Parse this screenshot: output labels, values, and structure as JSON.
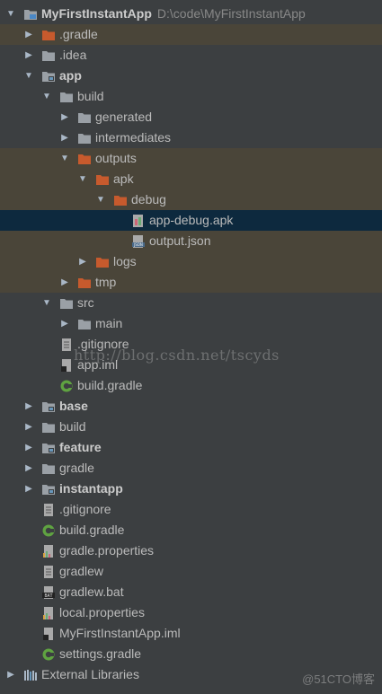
{
  "colors": {
    "background": "#3c3f41",
    "tint_row": "#4a4539",
    "selected_row": "#0d293e",
    "folder": "#b0b0b0",
    "excluded_folder": "#c75a2d",
    "text": "#bbbbbb"
  },
  "tree": [
    {
      "label": "MyFirstInstantApp",
      "path": "D:\\code\\MyFirstInstantApp",
      "depth": 0,
      "arrow": "down",
      "icon": "project-folder-icon",
      "bold": true
    },
    {
      "label": ".gradle",
      "depth": 1,
      "arrow": "right",
      "icon": "excluded-folder-icon",
      "tint": true
    },
    {
      "label": ".idea",
      "depth": 1,
      "arrow": "right",
      "icon": "folder-icon"
    },
    {
      "label": "app",
      "depth": 1,
      "arrow": "down",
      "icon": "module-folder-icon",
      "bold": true
    },
    {
      "label": "build",
      "depth": 2,
      "arrow": "down",
      "icon": "folder-icon"
    },
    {
      "label": "generated",
      "depth": 3,
      "arrow": "right",
      "icon": "folder-icon"
    },
    {
      "label": "intermediates",
      "depth": 3,
      "arrow": "right",
      "icon": "folder-icon"
    },
    {
      "label": "outputs",
      "depth": 3,
      "arrow": "down",
      "icon": "excluded-folder-icon",
      "tint": true
    },
    {
      "label": "apk",
      "depth": 4,
      "arrow": "down",
      "icon": "excluded-folder-icon",
      "tint": true
    },
    {
      "label": "debug",
      "depth": 5,
      "arrow": "down",
      "icon": "excluded-folder-icon",
      "tint": true
    },
    {
      "label": "app-debug.apk",
      "depth": 6,
      "arrow": "none",
      "icon": "apk-file-icon",
      "selected": true
    },
    {
      "label": "output.json",
      "depth": 6,
      "arrow": "none",
      "icon": "json-file-icon",
      "tint": true
    },
    {
      "label": "logs",
      "depth": 4,
      "arrow": "right",
      "icon": "excluded-folder-icon",
      "tint": true
    },
    {
      "label": "tmp",
      "depth": 3,
      "arrow": "right",
      "icon": "excluded-folder-icon",
      "tint": true
    },
    {
      "label": "src",
      "depth": 2,
      "arrow": "down",
      "icon": "folder-icon"
    },
    {
      "label": "main",
      "depth": 3,
      "arrow": "right",
      "icon": "folder-icon"
    },
    {
      "label": ".gitignore",
      "depth": 2,
      "arrow": "none",
      "icon": "text-file-icon"
    },
    {
      "label": "app.iml",
      "depth": 2,
      "arrow": "none",
      "icon": "iml-file-icon"
    },
    {
      "label": "build.gradle",
      "depth": 2,
      "arrow": "none",
      "icon": "gradle-file-icon"
    },
    {
      "label": "base",
      "depth": 1,
      "arrow": "right",
      "icon": "module-folder-icon",
      "bold": true
    },
    {
      "label": "build",
      "depth": 1,
      "arrow": "right",
      "icon": "folder-icon"
    },
    {
      "label": "feature",
      "depth": 1,
      "arrow": "right",
      "icon": "module-folder-icon",
      "bold": true
    },
    {
      "label": "gradle",
      "depth": 1,
      "arrow": "right",
      "icon": "folder-icon"
    },
    {
      "label": "instantapp",
      "depth": 1,
      "arrow": "right",
      "icon": "module-folder-icon",
      "bold": true
    },
    {
      "label": ".gitignore",
      "depth": 1,
      "arrow": "none",
      "icon": "text-file-icon"
    },
    {
      "label": "build.gradle",
      "depth": 1,
      "arrow": "none",
      "icon": "gradle-file-icon"
    },
    {
      "label": "gradle.properties",
      "depth": 1,
      "arrow": "none",
      "icon": "properties-file-icon"
    },
    {
      "label": "gradlew",
      "depth": 1,
      "arrow": "none",
      "icon": "text-file-icon"
    },
    {
      "label": "gradlew.bat",
      "depth": 1,
      "arrow": "none",
      "icon": "bat-file-icon"
    },
    {
      "label": "local.properties",
      "depth": 1,
      "arrow": "none",
      "icon": "properties-file-icon"
    },
    {
      "label": "MyFirstInstantApp.iml",
      "depth": 1,
      "arrow": "none",
      "icon": "iml-file-icon"
    },
    {
      "label": "settings.gradle",
      "depth": 1,
      "arrow": "none",
      "icon": "gradle-file-icon"
    },
    {
      "label": "External Libraries",
      "depth": 0,
      "arrow": "right",
      "icon": "libraries-icon"
    }
  ],
  "watermark": "http://blog.csdn.net/tscyds",
  "corner_watermark": "@51CTO博客"
}
